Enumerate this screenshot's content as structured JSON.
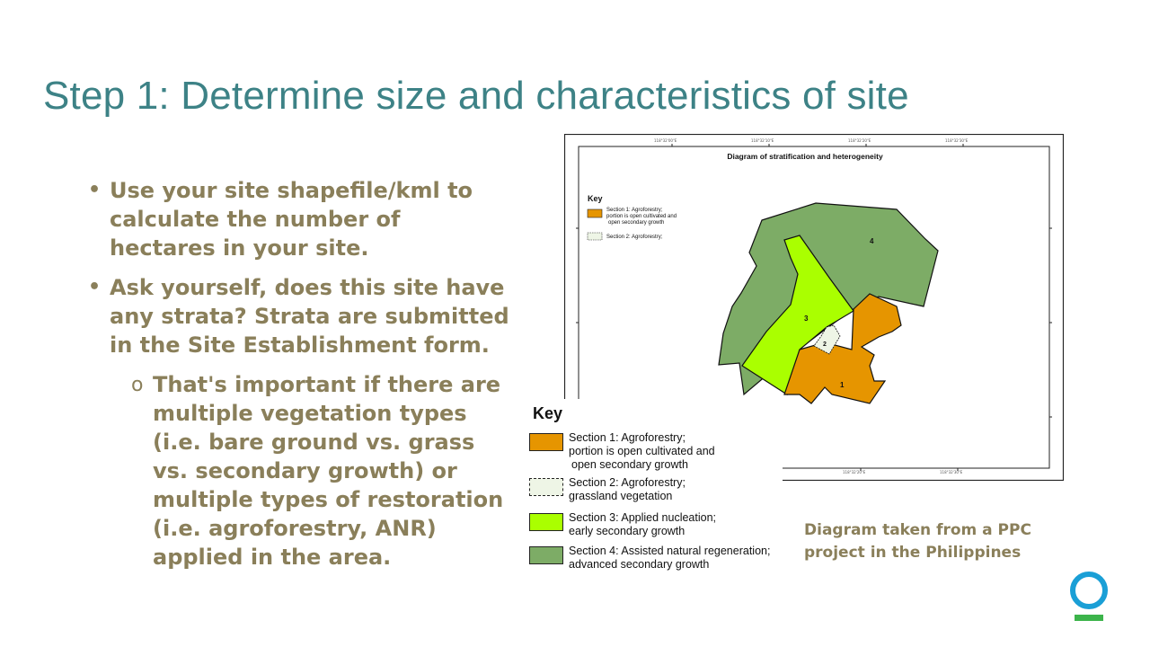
{
  "slide": {
    "title": "Step 1: Determine size and characteristics of site",
    "bullets": [
      {
        "text": "Use your site shapefile/kml to calculate the number of hectares in your site."
      },
      {
        "text": "Ask yourself, does this site have any strata? Strata are submitted in the Site Establishment form."
      }
    ],
    "sub_bullet": "That's important if there are multiple vegetation types (i.e. bare ground vs. grass vs. secondary growth) or multiple types of restoration (i.e. agroforestry, ANR) applied in the area.",
    "bullet_glyph": "•",
    "sub_glyph": "o",
    "caption_line1": "Diagram taken from a PPC",
    "caption_line2": "project in the Philippines"
  },
  "map": {
    "title": "Diagram of stratification and heterogeneity",
    "small_key": {
      "title": "Key",
      "s1_line1": "Section 1: Agroforestry;",
      "s1_line2": "portion is open cultivated and",
      "s1_line3": "open secondary growth",
      "s2_line1": "Section 2: Agroforestry;"
    },
    "labels": {
      "s1": "1",
      "s2": "2",
      "s3": "3",
      "s4": "4"
    },
    "colors": {
      "section1": "#e69500",
      "section2": "#eef5e6",
      "section3": "#aaff00",
      "section4": "#7dac66"
    }
  },
  "key": {
    "title": "Key",
    "items": [
      {
        "line1": "Section 1: Agroforestry;",
        "line2": "portion is open cultivated and",
        "line3": "open secondary growth"
      },
      {
        "line1": "Section 2: Agroforestry;",
        "line2": "grassland vegetation"
      },
      {
        "line1": "Section 3: Applied nucleation;",
        "line2": "early secondary growth"
      },
      {
        "line1": "Section 4: Assisted natural regeneration;",
        "line2": "advanced secondary growth"
      }
    ]
  },
  "logo": {
    "ring_color": "#1a9fd6",
    "bar_color": "#3cb44b"
  }
}
